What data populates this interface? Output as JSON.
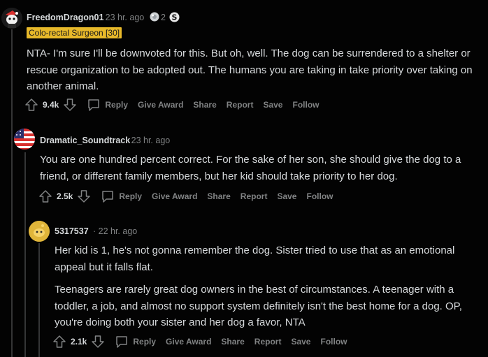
{
  "comments": [
    {
      "username": "FreedomDragon01",
      "time": "· 23 hr. ago",
      "award_count": "2",
      "flair": "Colo-rectal Surgeon [30]",
      "body": [
        "NTA- I'm sure I'll be downvoted for this. But oh, well. The dog can be surrendered to a shelter or rescue organization to be adopted out. The humans you are taking in take priority over taking on another animal."
      ],
      "score": "9.4k",
      "actions": {
        "reply": "Reply",
        "give_award": "Give Award",
        "share": "Share",
        "report": "Report",
        "save": "Save",
        "follow": "Follow"
      }
    },
    {
      "username": "Dramatic_Soundtrack",
      "time": "· 23 hr. ago",
      "body": [
        "You are one hundred percent correct. For the sake of her son, she should give the dog to a friend, or different family members, but her kid should take priority to her dog."
      ],
      "score": "2.5k",
      "actions": {
        "reply": "Reply",
        "give_award": "Give Award",
        "share": "Share",
        "report": "Report",
        "save": "Save",
        "follow": "Follow"
      }
    },
    {
      "username": "5317537",
      "time": "· 22 hr. ago",
      "body": [
        "Her kid is 1, he's not gonna remember the dog. Sister tried to use that as an emotional appeal but it falls flat.",
        "Teenagers are rarely great dog owners in the best of circumstances. A teenager with a toddler, a job, and almost no support system definitely isn't the best home for a dog. OP, you're doing both your sister and her dog a favor, NTA"
      ],
      "score": "2.1k",
      "actions": {
        "reply": "Reply",
        "give_award": "Give Award",
        "share": "Share",
        "report": "Report",
        "save": "Save",
        "follow": "Follow"
      }
    }
  ],
  "icons": {
    "upvote": "upvote-arrow-icon",
    "downvote": "downvote-arrow-icon",
    "reply": "speech-bubble-icon",
    "award": "award-icon",
    "coin": "coin-icon"
  },
  "colors": {
    "background": "#030303",
    "text": "#d7dadc",
    "muted": "#818384",
    "flair": "#e8b92a"
  }
}
